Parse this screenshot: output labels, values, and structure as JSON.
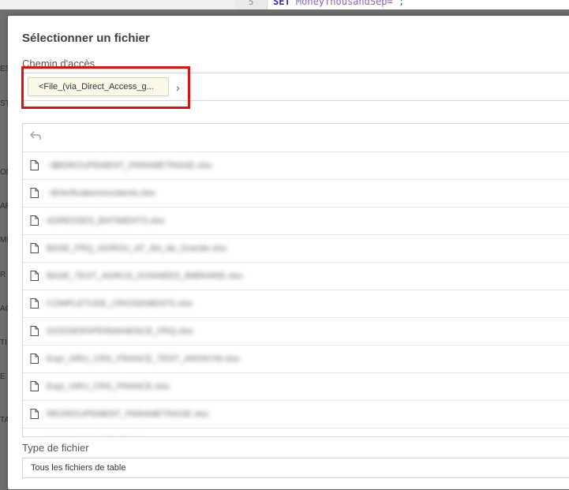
{
  "background": {
    "line_number": "5",
    "code_keyword": "SET",
    "code_identifier": "MoneyThousandSep=",
    "code_rest": " ;",
    "side_letters": [
      "ES",
      "ST",
      "ON",
      "AP",
      "MI",
      "R",
      "AC",
      "TI",
      "E",
      "TA"
    ]
  },
  "dialog": {
    "title": "Sélectionner un fichier",
    "path_label": "Chemin d'accès",
    "path_chip": "<File_(via_Direct_Access_g...",
    "path_arrow": "›",
    "back_icon": "undo-arrow-icon",
    "files": [
      "~$BDROUPEMENT_PARAMETRAGE.xlsx",
      "~$VerificationsIncidents.xlsx",
      "ADRESSES_BATIMENTS.xlsx",
      "BASE_FRQ_AGROU_AT_Ilot_de_Grande.xlsx",
      "BASE_TEST_AGRUS_DONNEES_BIBRARIE.xlsx",
      "COMPLETUDE_CROISEMENTS.xlsx",
      "DOSSIERSPERMANENCE_FRQ.xlsx",
      "Expr_GRU_CRS_FRANCE_TEST_ANONYM.xlsx",
      "Expr_GRU_CRS_FRANCE.xlsx",
      "REGROUPEMENT_PARAMETRAGE.xlsx",
      "SUIVI_INDICATEURS.xlsx"
    ],
    "type_label": "Type de fichier",
    "type_value": "Tous les fichiers de table"
  }
}
